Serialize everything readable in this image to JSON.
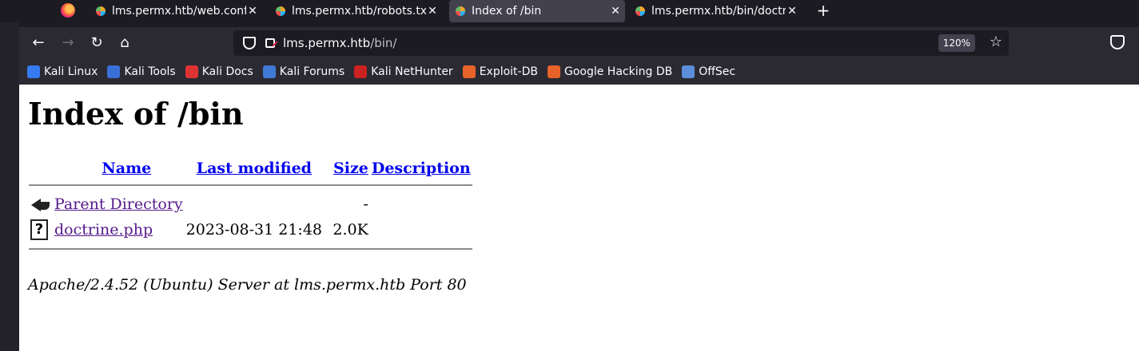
{
  "browser": {
    "tabs": [
      {
        "label": "lms.permx.htb/web.config",
        "active": false
      },
      {
        "label": "lms.permx.htb/robots.txt",
        "active": false
      },
      {
        "label": "Index of /bin",
        "active": true
      },
      {
        "label": "lms.permx.htb/bin/doctrine.php",
        "active": false
      }
    ],
    "new_tab": "+",
    "url_host": "lms.permx.htb",
    "url_path": "/bin/",
    "zoom": "120%",
    "bookmarks": [
      {
        "label": "Kali Linux",
        "color": "#367bf0"
      },
      {
        "label": "Kali Tools",
        "color": "#3a6fd8"
      },
      {
        "label": "Kali Docs",
        "color": "#d33"
      },
      {
        "label": "Kali Forums",
        "color": "#3f7ad6"
      },
      {
        "label": "Kali NetHunter",
        "color": "#c22"
      },
      {
        "label": "Exploit-DB",
        "color": "#e8632a"
      },
      {
        "label": "Google Hacking DB",
        "color": "#e8632a"
      },
      {
        "label": "OffSec",
        "color": "#5b8fd9"
      }
    ]
  },
  "page": {
    "title": "Index of /bin",
    "columns": {
      "name": "Name",
      "last_modified": "Last modified",
      "size": "Size",
      "description": "Description"
    },
    "rows": [
      {
        "icon": "back-icon",
        "name": "Parent Directory",
        "last_modified": "",
        "size": "-",
        "description": ""
      },
      {
        "icon": "unknown-file-icon",
        "name": "doctrine.php",
        "last_modified": "2023-08-31 21:48",
        "size": "2.0K",
        "description": ""
      }
    ],
    "address": "Apache/2.4.52 (Ubuntu) Server at lms.permx.htb Port 80"
  }
}
